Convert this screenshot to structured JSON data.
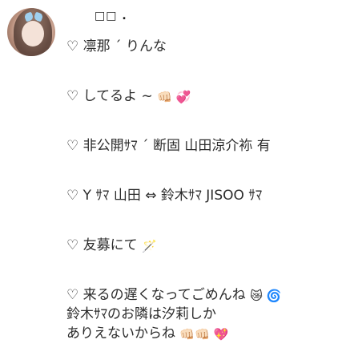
{
  "profile": {
    "username": "□□ .",
    "avatar_desc": "profile-photo"
  },
  "bio": {
    "line1": "♡ 凛那 ´ りんな",
    "line2_text": "♡ してるよ ~ ",
    "line2_emoji": "👊🏻 💞",
    "line3": "♡ 非公開ｻﾏ ´ 断固 山田涼介袮 有",
    "line4": "♡ Y ｻﾏ 山田 ⇔ 鈴木ｻﾏ JISOO ｻﾏ",
    "line5_text": "♡ 友募にて ",
    "line5_emoji": "🪄",
    "line6_text": "♡ 来るの遅くなってごめんね ",
    "line6_emoji": "😿 🌀",
    "line7": "鈴木ｻﾏのお隣は汐莉しか",
    "line8_text": "ありえないからね ",
    "line8_emoji": "👊🏻👊🏻 💖"
  }
}
